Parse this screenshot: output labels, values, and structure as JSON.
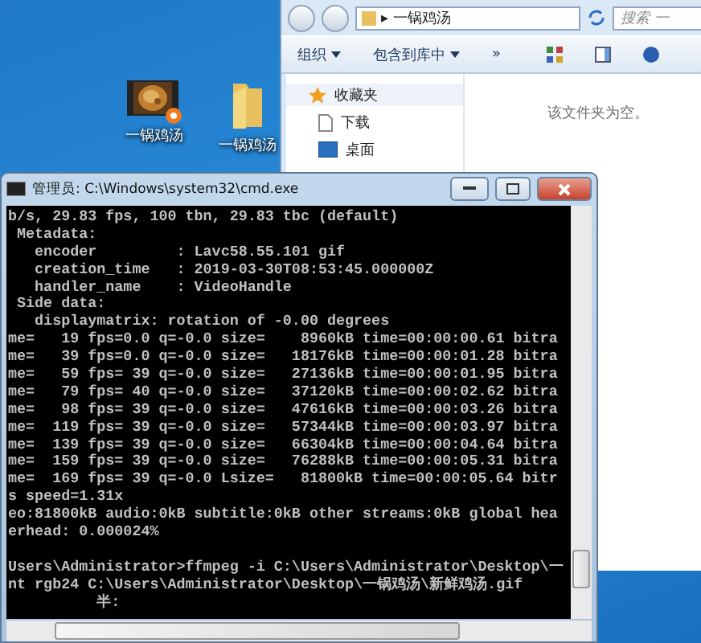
{
  "desktop": {
    "icons": [
      {
        "label": "一锅鸡汤",
        "kind": "video"
      },
      {
        "label": "一锅鸡汤",
        "kind": "folder"
      }
    ]
  },
  "explorer": {
    "address_separator": "▸",
    "address": "一锅鸡汤",
    "search_placeholder": "搜索 一",
    "toolbar": [
      {
        "label": "组织",
        "kind": "menu"
      },
      {
        "label": "包含到库中",
        "kind": "menu"
      },
      {
        "label": "»",
        "kind": "more"
      }
    ],
    "nav": [
      {
        "label": "收藏夹",
        "kind": "favorites",
        "selected": true
      },
      {
        "label": "下载",
        "kind": "downloads",
        "selected": false
      },
      {
        "label": "桌面",
        "kind": "desktop",
        "selected": false
      }
    ],
    "empty_message": "该文件夹为空。"
  },
  "cmd": {
    "title": "管理员: C:\\Windows\\system32\\cmd.exe",
    "lines": [
      "b/s, 29.83 fps, 100 tbn, 29.83 tbc (default)",
      " Metadata:",
      "   encoder         : Lavc58.55.101 gif",
      "   creation_time   : 2019-03-30T08:53:45.000000Z",
      "   handler_name    : VideoHandle",
      " Side data:",
      "   displaymatrix: rotation of -0.00 degrees",
      "me=   19 fps=0.0 q=-0.0 size=    8960kB time=00:00:00.61 bitra",
      "me=   39 fps=0.0 q=-0.0 size=   18176kB time=00:00:01.28 bitra",
      "me=   59 fps= 39 q=-0.0 size=   27136kB time=00:00:01.95 bitra",
      "me=   79 fps= 40 q=-0.0 size=   37120kB time=00:00:02.62 bitra",
      "me=   98 fps= 39 q=-0.0 size=   47616kB time=00:00:03.26 bitra",
      "me=  119 fps= 39 q=-0.0 size=   57344kB time=00:00:03.97 bitra",
      "me=  139 fps= 39 q=-0.0 size=   66304kB time=00:00:04.64 bitra",
      "me=  159 fps= 39 q=-0.0 size=   76288kB time=00:00:05.31 bitra",
      "me=  169 fps= 39 q=-0.0 Lsize=   81800kB time=00:00:05.64 bitr",
      "s speed=1.31x",
      "eo:81800kB audio:0kB subtitle:0kB other streams:0kB global hea",
      "erhead: 0.000024%"
    ],
    "prompt_lines": [
      "Users\\Administrator>ffmpeg -i C:\\Users\\Administrator\\Desktop\\一",
      "nt rgb24 C:\\Users\\Administrator\\Desktop\\一锅鸡汤\\新鲜鸡汤.gif",
      "          半:"
    ]
  }
}
